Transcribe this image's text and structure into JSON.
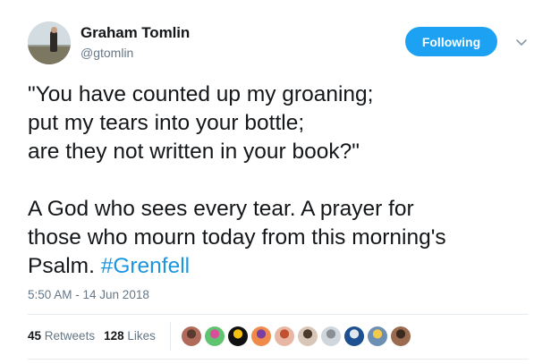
{
  "author": {
    "name": "Graham Tomlin",
    "handle": "@gtomlin"
  },
  "follow_button": {
    "label": "Following"
  },
  "tweet": {
    "text_main": "\"You have counted up my groaning;\nput my tears into your bottle;\nare they not written in your book?\"\n\nA God who sees every tear. A prayer for\nthose who mourn today from this morning's\nPsalm. ",
    "hashtag": "#Grenfell"
  },
  "timestamp": "5:50 AM - 14 Jun 2018",
  "stats": {
    "retweets_count": "45",
    "retweets_label": "Retweets",
    "likes_count": "128",
    "likes_label": "Likes"
  },
  "likers": [
    {
      "color": "#b06a5a",
      "accent": "#5a3a30"
    },
    {
      "color": "#5fc36f",
      "accent": "#d94f9c"
    },
    {
      "color": "#111111",
      "accent": "#f4c20d"
    },
    {
      "color": "#f08a4b",
      "accent": "#7a3fa0"
    },
    {
      "color": "#e7b7a4",
      "accent": "#c0502f"
    },
    {
      "color": "#d8c7b8",
      "accent": "#4b3a2e"
    },
    {
      "color": "#cfd6dc",
      "accent": "#8a8f95"
    },
    {
      "color": "#1d4f91",
      "accent": "#e0e6ee"
    },
    {
      "color": "#6c8fb3",
      "accent": "#f2c94c"
    },
    {
      "color": "#9a6b4f",
      "accent": "#3b2a20"
    }
  ]
}
